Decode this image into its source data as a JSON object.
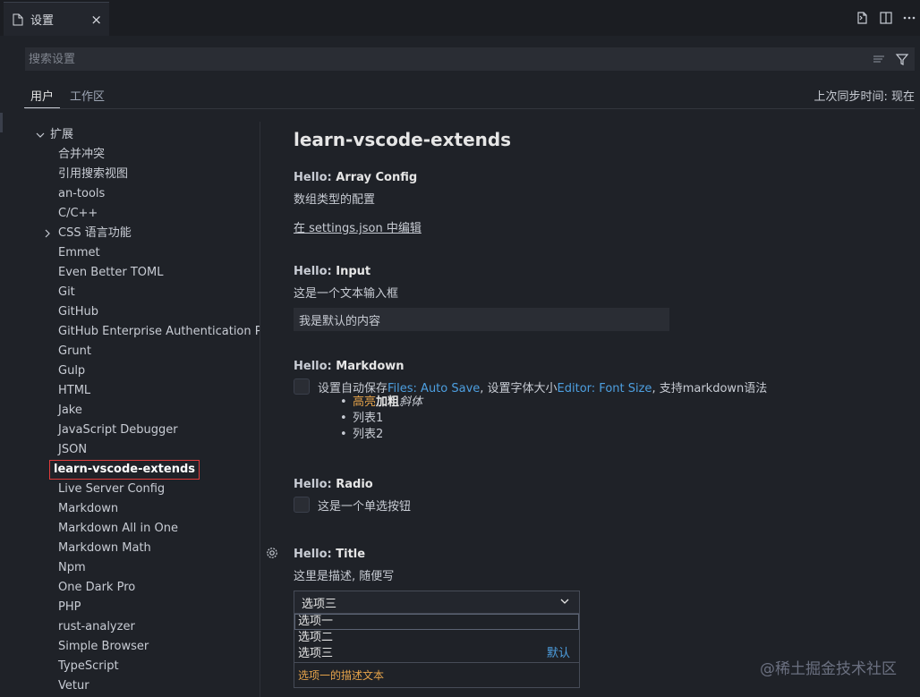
{
  "tab": {
    "title": "设置",
    "close": "×"
  },
  "search": {
    "placeholder": "搜索设置"
  },
  "scope_tabs": [
    {
      "label": "用户"
    },
    {
      "label": "工作区"
    }
  ],
  "sync_status": "上次同步时间: 现在",
  "toc": {
    "group": "扩展",
    "items": [
      "合并冲突",
      "引用搜索视图",
      "an-tools",
      "C/C++",
      "CSS 语言功能",
      "Emmet",
      "Even Better TOML",
      "Git",
      "GitHub",
      "GitHub Enterprise Authentication Pro...",
      "Grunt",
      "Gulp",
      "HTML",
      "Jake",
      "JavaScript Debugger",
      "JSON",
      "learn-vscode-extends",
      "Live Server Config",
      "Markdown",
      "Markdown All in One",
      "Markdown Math",
      "Npm",
      "One Dark Pro",
      "PHP",
      "rust-analyzer",
      "Simple Browser",
      "TypeScript",
      "Vetur"
    ],
    "selected": "learn-vscode-extends"
  },
  "main": {
    "section_title": "learn-vscode-extends",
    "array_config": {
      "category": "Hello: ",
      "name": "Array Config",
      "description": "数组类型的配置",
      "edit_link": "在 settings.json 中编辑"
    },
    "input": {
      "category": "Hello: ",
      "name": "Input",
      "description": "这是一个文本输入框",
      "value": "我是默认的内容"
    },
    "markdown": {
      "category": "Hello: ",
      "name": "Markdown",
      "text_1": "设置自动保存",
      "link_1": "Files: Auto Save",
      "text_2": ", 设置字体大小",
      "link_2": "Editor: Font Size",
      "text_3": ", 支持markdown语法",
      "list": {
        "highlight": "高亮",
        "bold": "加粗",
        "italic": "斜体",
        "item_2": "列表1",
        "item_3": "列表2"
      }
    },
    "radio": {
      "category": "Hello: ",
      "name": "Radio",
      "description": "这是一个单选按钮"
    },
    "title": {
      "category": "Hello: ",
      "name": "Title",
      "description": "这里是描述, 随便写",
      "selected": "选项三",
      "options": [
        "选项一",
        "选项二",
        "选项三"
      ],
      "default_label": "默认",
      "option_description": "选项一的描述文本"
    }
  },
  "watermark": "@稀土掘金技术社区",
  "colors": {
    "link": "#4d9fe0",
    "highlight": "#e5a34a",
    "selected_outline": "#e23b3b"
  }
}
